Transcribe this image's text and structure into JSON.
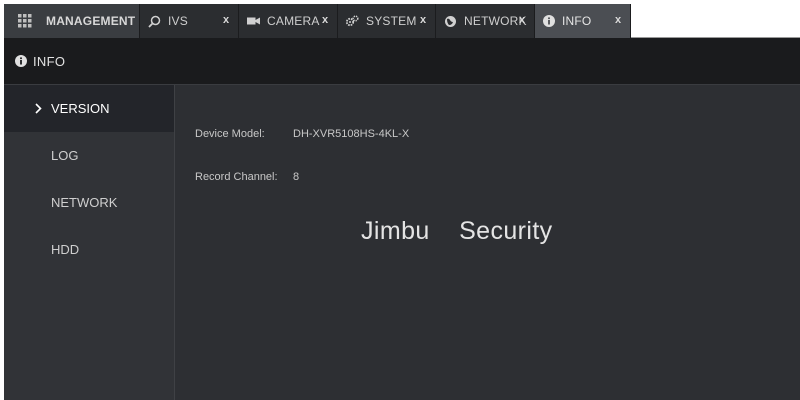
{
  "tabs": {
    "management": {
      "label": "MANAGEMENT",
      "icon": "grid-icon"
    },
    "items": [
      {
        "label": "IVS",
        "icon": "ivs-search-icon",
        "close": "x"
      },
      {
        "label": "CAMERA",
        "icon": "camera-icon",
        "close": "x"
      },
      {
        "label": "SYSTEM",
        "icon": "gears-icon",
        "close": "x"
      },
      {
        "label": "NETWORK",
        "icon": "globe-icon",
        "close": "x"
      },
      {
        "label": "INFO",
        "icon": "info-icon",
        "close": "x",
        "active": true
      }
    ]
  },
  "header": {
    "title": "INFO",
    "icon": "info-icon"
  },
  "sidebar": {
    "items": [
      {
        "label": "VERSION",
        "active": true
      },
      {
        "label": "LOG"
      },
      {
        "label": "NETWORK"
      },
      {
        "label": "HDD"
      }
    ]
  },
  "version": {
    "device_model_label": "Device Model:",
    "device_model_value": "DH-XVR5108HS-4KL-X",
    "record_channel_label": "Record Channel:",
    "record_channel_value": "8"
  },
  "watermark": "Jimbu    Security",
  "colors": {
    "background": "#26282b",
    "active_tab": "#4b4e53",
    "sidebar": "#313337",
    "sidebar_active": "#23252a",
    "header": "#1a1b1d"
  }
}
